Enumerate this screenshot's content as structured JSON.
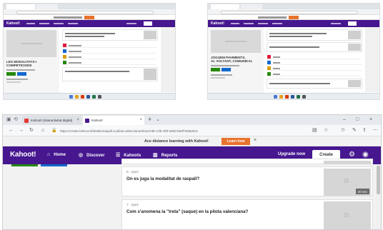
{
  "main_browser": {
    "tabs": [
      {
        "label": "Kahoot! (Interactivitat digital)",
        "favicon_color": "#e53935"
      },
      {
        "label": "Kahoot!",
        "favicon_color": "#46178f"
      }
    ],
    "url": "https://create.kahoot.it/details/raspall-a-pilota-valenciana/2fea47d8-c1fb-4f2f-a9d3-b9df76d6d3c5",
    "banner": {
      "text": "Ace distance learning with Kahoot!",
      "button": "Learn how",
      "close": "×"
    },
    "nav": {
      "logo": "Kahoot!",
      "items": [
        {
          "label": "Home",
          "icon": "home-icon",
          "glyph": "⌂"
        },
        {
          "label": "Discover",
          "icon": "compass-icon",
          "glyph": "◎"
        },
        {
          "label": "Kahoots",
          "icon": "list-icon",
          "glyph": "☰"
        },
        {
          "label": "Reports",
          "icon": "bar-chart-icon",
          "glyph": "▥"
        }
      ],
      "upgrade": "Upgrade now",
      "create": "Create"
    },
    "questions": [
      {
        "number": "6 - Quiz",
        "title": "On es juga la modalitat de raspall?",
        "time": "20 sec"
      },
      {
        "number": "7 - Quiz",
        "title": "Com s'anomena la \"treta\" (saque) en la pilota valenciana?",
        "time": ""
      }
    ],
    "colors": {
      "kahoot_purple": "#46178f",
      "banner_orange": "#e8732c",
      "green": "#26890c",
      "blue": "#1368ce"
    }
  },
  "thumbnail_left": {
    "title_lines": [
      "LES MODALITATS I",
      "COMPETICIONS"
    ],
    "answer_colors": [
      "#e21b3c",
      "#1368ce",
      "#d89e00",
      "#26890c"
    ]
  },
  "thumbnail_right": {
    "title_lines": [
      "JOGUEM PAVIMENTS,",
      "AL VOLTANT, COMUNIKAL"
    ],
    "answer_colors": [
      "#e21b3c",
      "#1368ce",
      "#d89e00",
      "#26890c"
    ]
  }
}
